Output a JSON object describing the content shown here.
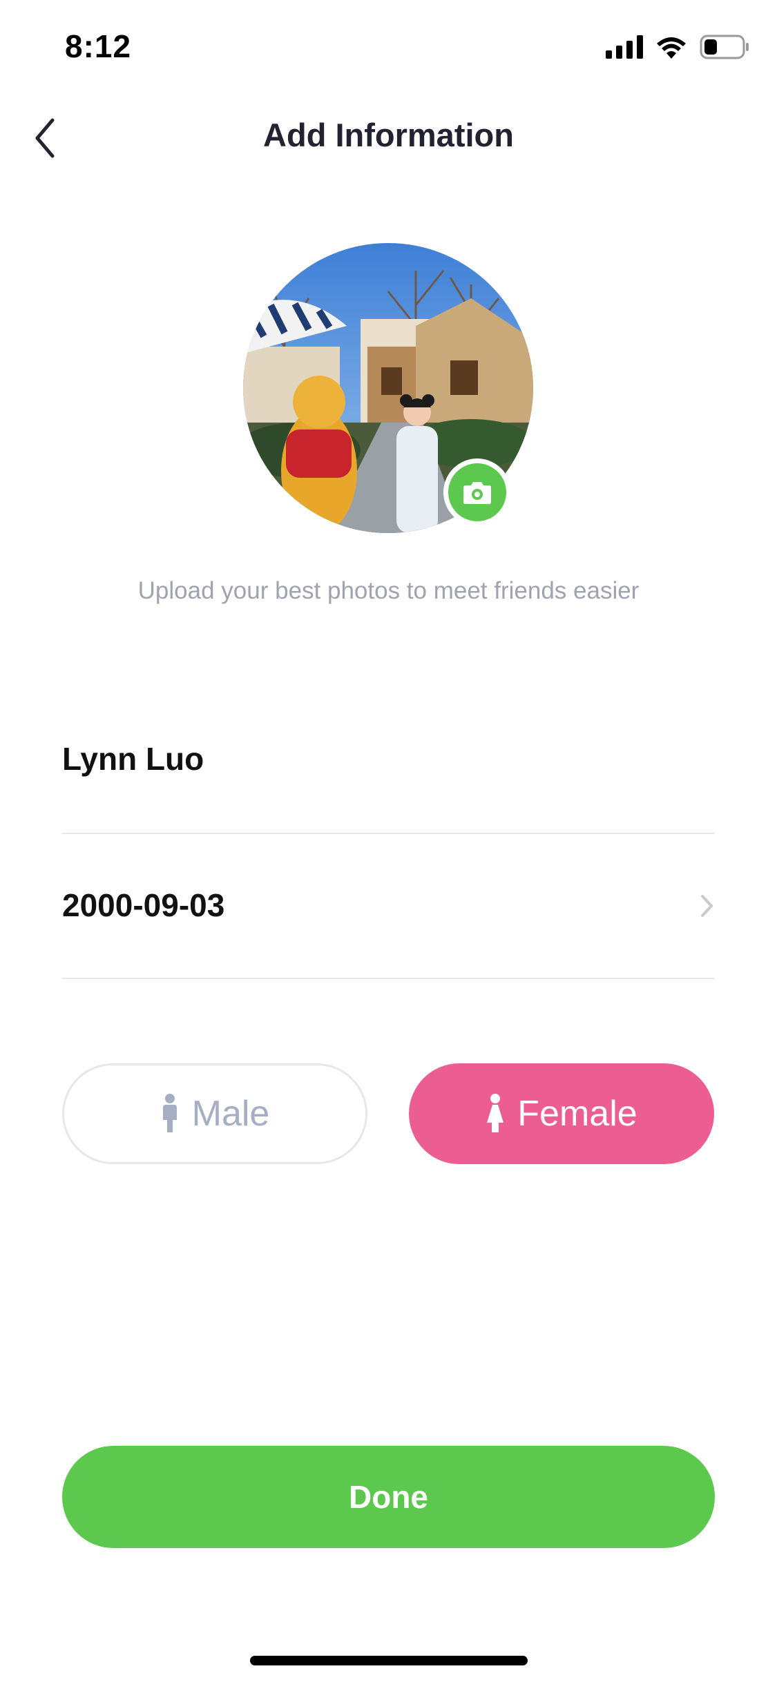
{
  "status_bar": {
    "time": "8:12",
    "signal_icon": "cellular-signal-icon",
    "wifi_icon": "wifi-icon",
    "battery_icon": "battery-icon",
    "battery_level": 0.35
  },
  "header": {
    "title": "Add Information",
    "back_icon": "chevron-left-icon"
  },
  "avatar": {
    "image": "profile-photo",
    "camera_icon": "camera-icon",
    "camera_color": "#5CC94E"
  },
  "upload_hint": "Upload your best photos to meet friends easier",
  "form": {
    "name": "Lynn Luo",
    "birthday": "2000-09-03",
    "birthday_chevron": "chevron-right-icon"
  },
  "gender": {
    "male_label": "Male",
    "female_label": "Female",
    "selected": "Female",
    "male_icon": "male-person-icon",
    "female_icon": "female-person-icon",
    "female_color": "#EC5E92"
  },
  "done_label": "Done",
  "colors": {
    "accent_green": "#5CC94E",
    "accent_pink": "#EC5E92",
    "muted_text": "#9FA3AE"
  }
}
